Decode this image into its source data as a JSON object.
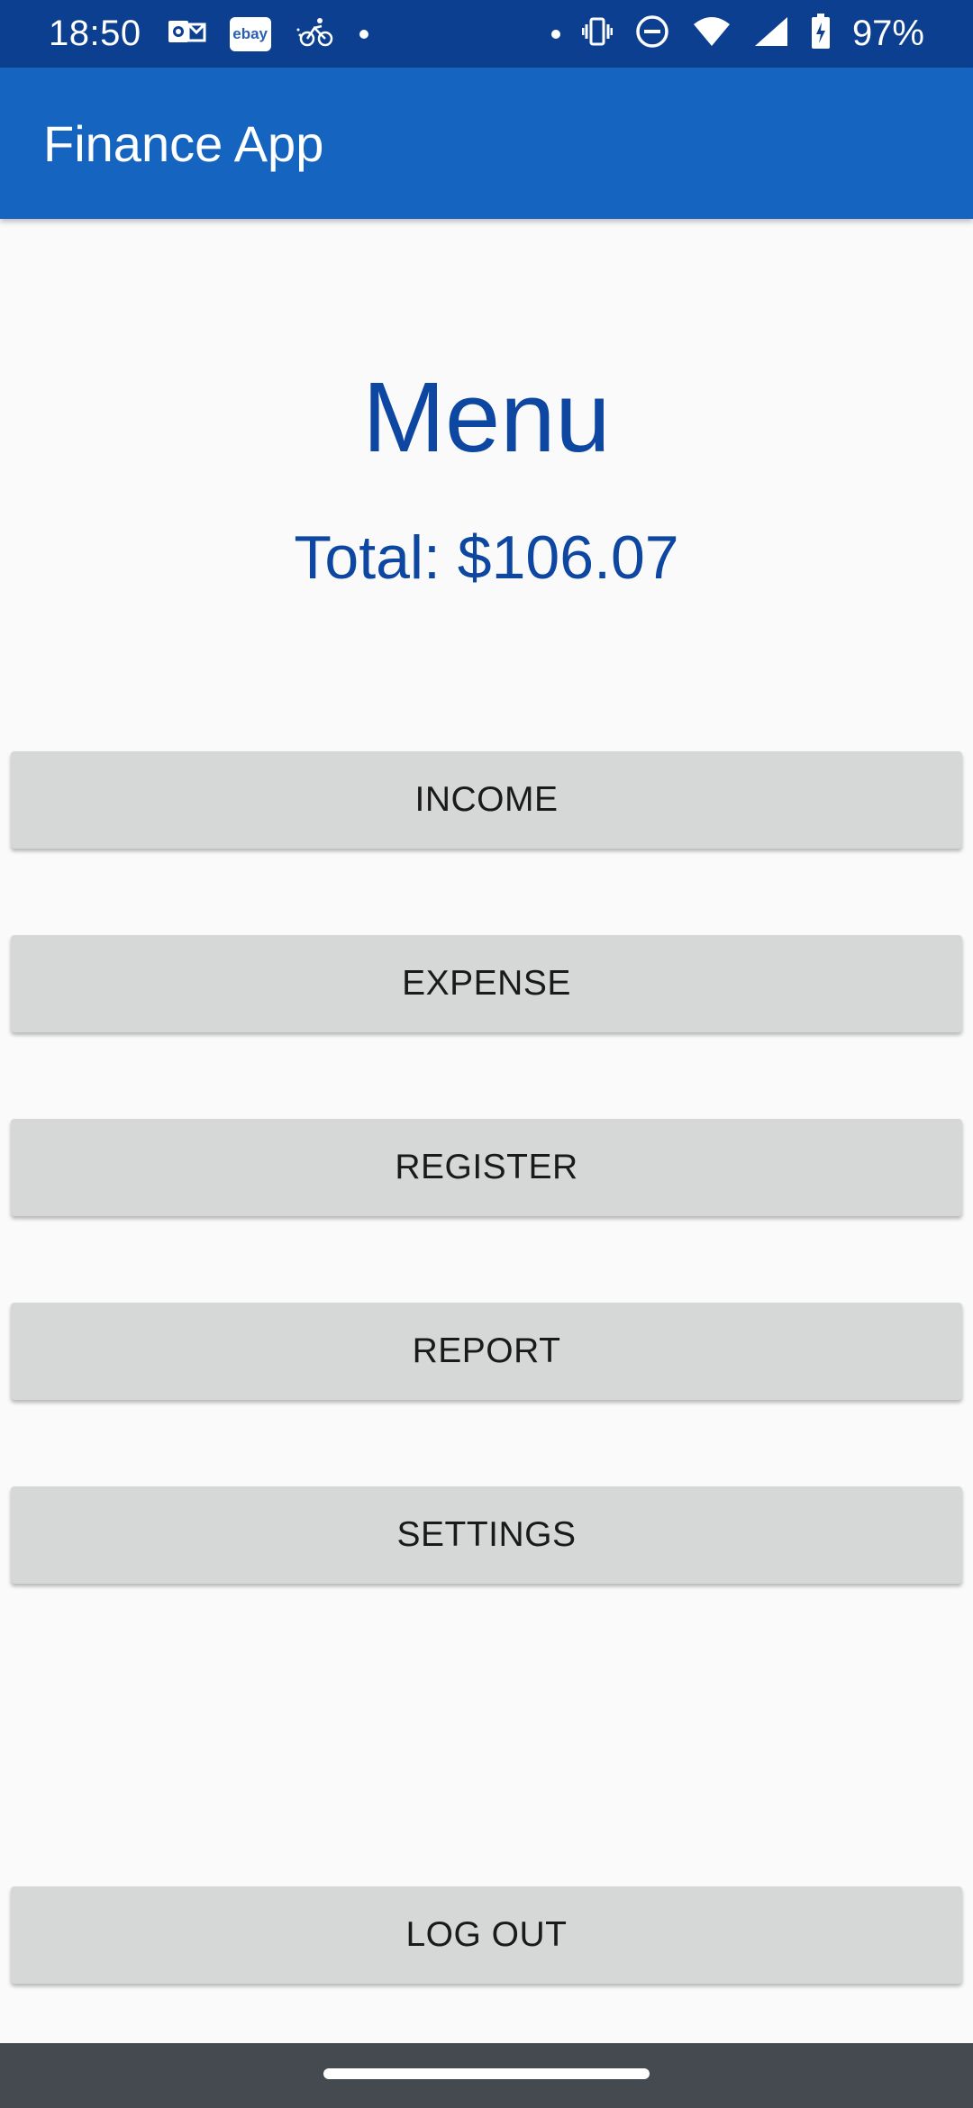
{
  "status_bar": {
    "time": "18:50",
    "notification_icons": [
      "outlook-icon",
      "ebay-icon",
      "postmates-icon",
      "dot-icon"
    ],
    "ebay_label": "ebay",
    "system_icons": [
      "dot-icon",
      "vibrate-icon",
      "do-not-disturb-icon",
      "wifi-icon",
      "cell-signal-icon",
      "battery-charging-icon"
    ],
    "battery": "97%"
  },
  "app_bar": {
    "title": "Finance App",
    "color": "#1565c0"
  },
  "main": {
    "heading": "Menu",
    "total": "Total: $106.07",
    "buttons": [
      {
        "label": "INCOME"
      },
      {
        "label": "EXPENSE"
      },
      {
        "label": "REGISTER"
      },
      {
        "label": "REPORT"
      },
      {
        "label": "SETTINGS"
      }
    ],
    "logout_label": "LOG OUT"
  },
  "colors": {
    "status_bar": "#0d3f91",
    "heading_text": "#0d47a1",
    "button_bg": "#d6d7d7",
    "nav_bar": "#454a50"
  }
}
